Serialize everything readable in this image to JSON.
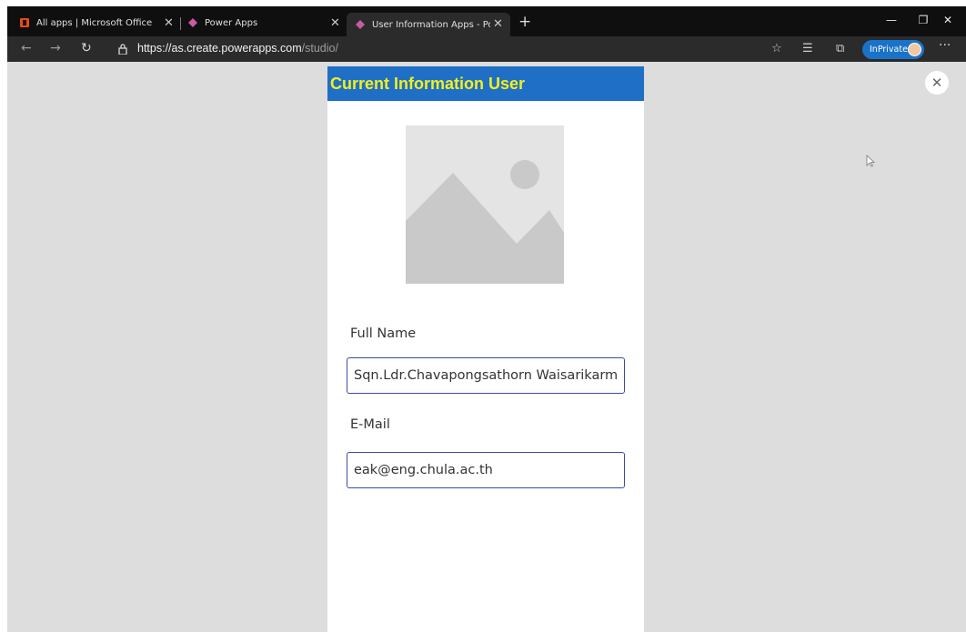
{
  "browser": {
    "tabs": [
      {
        "title": "All apps | Microsoft Office",
        "icon": "office-icon"
      },
      {
        "title": "Power Apps",
        "icon": "powerapps-icon"
      },
      {
        "title": "User Information Apps - Power A",
        "icon": "powerapps-icon",
        "active": true
      }
    ],
    "new_tab": "+",
    "url": "https://as.create.powerapps.com",
    "url_path": "/studio/",
    "inprivate_label": "InPrivate",
    "more": "···"
  },
  "app": {
    "title": "Current Information User",
    "image_icon": "image-placeholder-icon",
    "fields": [
      {
        "label": "Full Name",
        "value": "Sqn.Ldr.Chavapongsathorn Waisarikarm"
      },
      {
        "label": "E-Mail",
        "value": "eak@eng.chula.ac.th"
      }
    ]
  },
  "colors": {
    "app_header": "#1f6fc6",
    "app_title": "#f3ef1d",
    "field_border": "#3b4aa8",
    "inprivate": "#1a73c9"
  }
}
